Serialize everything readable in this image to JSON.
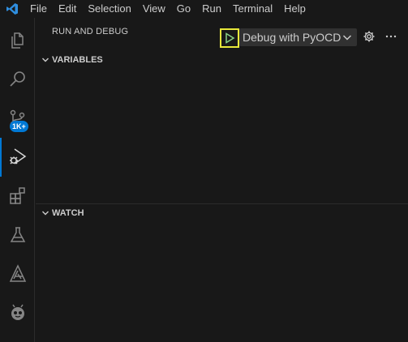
{
  "menu": [
    "File",
    "Edit",
    "Selection",
    "View",
    "Go",
    "Run",
    "Terminal",
    "Help"
  ],
  "activity": {
    "explorer": "explorer-icon",
    "search": "search-icon",
    "source_control": "source-control-icon",
    "source_control_badge": "1K+",
    "run_debug": "run-debug-icon",
    "extensions": "extensions-icon",
    "testing": "flask-icon",
    "cmsis": "cmsis-icon",
    "platformio": "platformio-icon"
  },
  "sidebar": {
    "title": "RUN AND DEBUG",
    "config_selected": "Debug with PyOCD",
    "sections": {
      "variables": "VARIABLES",
      "watch": "WATCH"
    }
  },
  "colors": {
    "accent": "#0078d4",
    "highlight_outline": "#e8e83a",
    "play_green": "#89d185",
    "background": "#181818"
  }
}
